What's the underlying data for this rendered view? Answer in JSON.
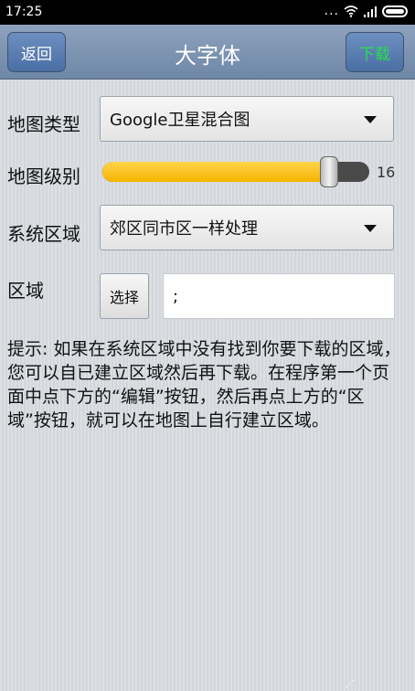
{
  "status_bar": {
    "time": "17:25",
    "dots": "...",
    "signal_text": ".ıll"
  },
  "header": {
    "back_label": "返回",
    "title": "大字体",
    "download_label": "下载",
    "download_color": "#27e04a"
  },
  "form": {
    "map_type": {
      "label": "地图类型",
      "value": "Google卫星混合图"
    },
    "map_level": {
      "label": "地图级别",
      "value": 16,
      "value_text": "16",
      "fill_fraction": 0.85
    },
    "system_region": {
      "label": "系统区域",
      "value": "郊区同市区一样处理"
    },
    "region": {
      "label": "区域",
      "select_label": "选择",
      "value": ";"
    }
  },
  "hint": {
    "text": "提示: 如果在系统区域中没有找到你要下载的区域，您可以自已建立区域然后再下载。在程序第一个页面中点下方的“编辑”按钮，然后再点上方的“区域”按钮，就可以在地图上自行建立区域。"
  },
  "footer": {
    "mark": "⋰"
  }
}
